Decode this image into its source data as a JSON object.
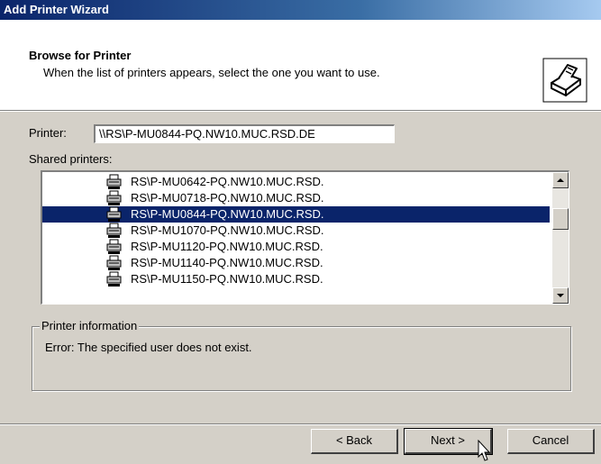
{
  "window": {
    "title": "Add Printer Wizard"
  },
  "header": {
    "title": "Browse for Printer",
    "subtitle": "When the list of printers appears, select the one you want to use.",
    "icon": "printer-wizard-icon"
  },
  "printer_field": {
    "label": "Printer:",
    "value": "\\\\RS\\P-MU0844-PQ.NW10.MUC.RSD.DE"
  },
  "shared": {
    "label": "Shared printers:",
    "items": [
      {
        "label": "RS\\P-MU0642-PQ.NW10.MUC.RSD.",
        "selected": false
      },
      {
        "label": "RS\\P-MU0718-PQ.NW10.MUC.RSD.",
        "selected": false
      },
      {
        "label": "RS\\P-MU0844-PQ.NW10.MUC.RSD.",
        "selected": true
      },
      {
        "label": "RS\\P-MU1070-PQ.NW10.MUC.RSD.",
        "selected": false
      },
      {
        "label": "RS\\P-MU1120-PQ.NW10.MUC.RSD.",
        "selected": false
      },
      {
        "label": "RS\\P-MU1140-PQ.NW10.MUC.RSD.",
        "selected": false
      },
      {
        "label": "RS\\P-MU1150-PQ.NW10.MUC.RSD.",
        "selected": false
      }
    ]
  },
  "info": {
    "legend": "Printer information",
    "text": "Error: The specified user does not exist."
  },
  "buttons": {
    "back": "< Back",
    "next": "Next >",
    "cancel": "Cancel"
  },
  "colors": {
    "selection": "#0a246a",
    "dialog_bg": "#d4d0c8",
    "title_start": "#0a246a",
    "title_end": "#a6caf0"
  }
}
